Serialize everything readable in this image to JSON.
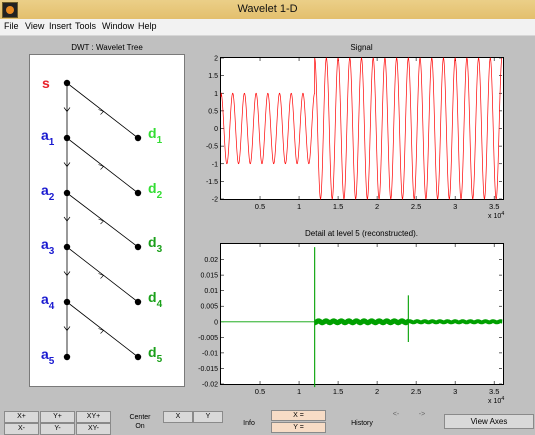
{
  "window": {
    "title": "Wavelet 1-D"
  },
  "menu": [
    "File",
    "View",
    "Insert",
    "Tools",
    "Window",
    "Help"
  ],
  "tree": {
    "title": "DWT : Wavelet Tree",
    "root": "s",
    "approx": [
      {
        "base": "a",
        "sub": "1"
      },
      {
        "base": "a",
        "sub": "2"
      },
      {
        "base": "a",
        "sub": "3"
      },
      {
        "base": "a",
        "sub": "4"
      },
      {
        "base": "a",
        "sub": "5"
      }
    ],
    "details": [
      {
        "base": "d",
        "sub": "1"
      },
      {
        "base": "d",
        "sub": "2"
      },
      {
        "base": "d",
        "sub": "3"
      },
      {
        "base": "d",
        "sub": "4"
      },
      {
        "base": "d",
        "sub": "5"
      }
    ],
    "colors": {
      "root": "#e8202a",
      "approx": "#1a1ad0",
      "detail_light": "#33dd33",
      "detail_dark": "#1aa01a"
    }
  },
  "chart_data": [
    {
      "type": "line",
      "title": "Signal",
      "color": "#ff0000",
      "xlim": [
        0,
        36000
      ],
      "ylim": [
        -2,
        2
      ],
      "xticks": [
        "0.5",
        "1",
        "1.5",
        "2",
        "2.5",
        "3",
        "3.5"
      ],
      "yticks": [
        "2",
        "1.5",
        "1",
        "0.5",
        "0",
        "-0.5",
        "-1",
        "-1.5",
        "-2"
      ],
      "x_multiplier": "x 10",
      "x_exponent": "4",
      "segments": [
        {
          "x_start": 0,
          "x_end": 12000,
          "amplitude": 1,
          "cycles": 8
        },
        {
          "x_start": 12000,
          "x_end": 36000,
          "amplitude": 2,
          "cycles": 16
        }
      ]
    },
    {
      "type": "line",
      "title": "Detail at level 5 (reconstructed).",
      "color": "#00a000",
      "xlim": [
        0,
        36000
      ],
      "ylim": [
        -0.02,
        0.025
      ],
      "xticks": [
        "0.5",
        "1",
        "1.5",
        "2",
        "2.5",
        "3",
        "3.5"
      ],
      "yticks": [
        "0.02",
        "0.015",
        "0.01",
        "0.005",
        "0",
        "-0.005",
        "-0.01",
        "-0.015",
        "-0.02"
      ],
      "x_multiplier": "x 10",
      "x_exponent": "4",
      "spikes": [
        {
          "x": 12000,
          "y_max": 0.024,
          "y_min": -0.021
        },
        {
          "x": 24000,
          "y_max": 0.0085,
          "y_min": -0.0065
        }
      ]
    }
  ],
  "controls": {
    "row1": [
      "X+",
      "Y+",
      "XY+"
    ],
    "row2": [
      "X-",
      "Y-",
      "XY-"
    ],
    "center_label": "Center",
    "on_label": "On",
    "x_label": "X",
    "y_label": "Y",
    "info_label": "Info",
    "x_eq": "X =",
    "y_eq": "Y =",
    "history_label": "History",
    "back_arrow": "<-",
    "fwd_arrow": "->",
    "view_axes_label": "View Axes"
  }
}
